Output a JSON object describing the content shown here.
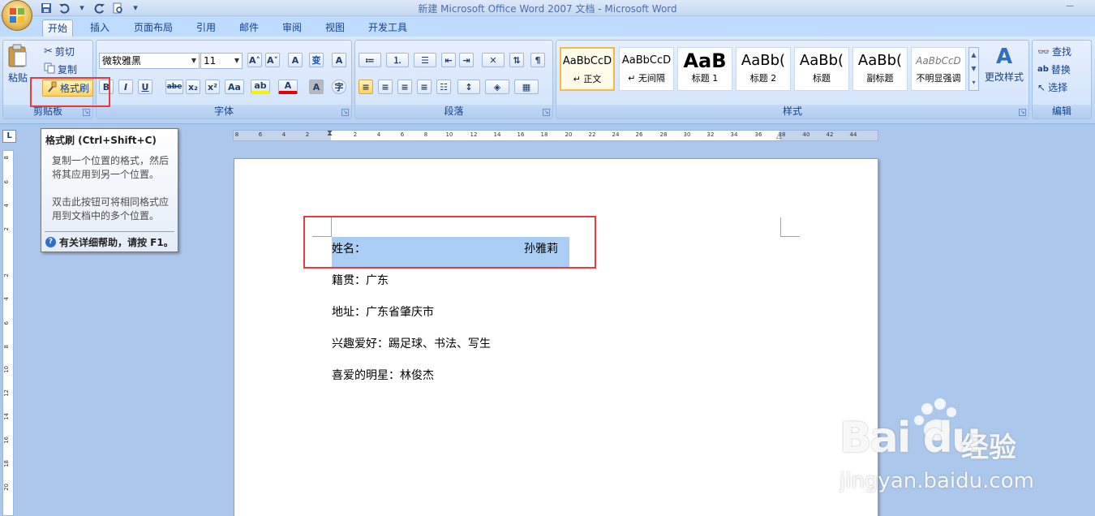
{
  "window": {
    "title": "新建 Microsoft Office Word 2007 文档 - Microsoft Word",
    "minimize_glyph": "—"
  },
  "quick_access": {
    "icons": [
      "save-icon",
      "undo-icon",
      "dropdown-icon",
      "redo-icon",
      "print-preview-icon",
      "customize-icon"
    ],
    "undo_arrow": "▾",
    "customize_arrow": "▾"
  },
  "tabs": [
    {
      "label": "开始",
      "active": true
    },
    {
      "label": "插入"
    },
    {
      "label": "页面布局"
    },
    {
      "label": "引用"
    },
    {
      "label": "邮件"
    },
    {
      "label": "审阅"
    },
    {
      "label": "视图"
    },
    {
      "label": "开发工具"
    }
  ],
  "clipboard": {
    "group_label": "剪贴板",
    "paste_label": "粘贴",
    "cut_label": "剪切",
    "copy_label": "复制",
    "format_painter_label": "格式刷"
  },
  "font": {
    "group_label": "字体",
    "font_name": "微软雅黑",
    "font_size": "11",
    "bold": "B",
    "italic": "I",
    "underline": "U",
    "strikethrough": "abe",
    "subscript": "x₂",
    "superscript": "x²",
    "change_case": "Aa",
    "highlight": "ab",
    "font_color": "A",
    "char_shading": "A",
    "enclose": "字",
    "grow": "A˄",
    "shrink": "A˅",
    "clear": "A",
    "phonetic": "变",
    "border": "A",
    "highlight_color": "#f7f000",
    "font_color_bar": "#e40000"
  },
  "paragraph": {
    "group_label": "段落"
  },
  "styles": {
    "group_label": "样式",
    "items": [
      {
        "sample": "AaBbCcD",
        "name": "↵ 正文",
        "selected": true
      },
      {
        "sample": "AaBbCcD",
        "name": "↵ 无间隔"
      },
      {
        "sample": "AaB",
        "name": "标题 1"
      },
      {
        "sample": "AaBb(",
        "name": "标题 2"
      },
      {
        "sample": "AaBb(",
        "name": "标题"
      },
      {
        "sample": "AaBb(",
        "name": "副标题"
      },
      {
        "sample": "AaBbCcD",
        "name": "不明显强调"
      }
    ],
    "change_styles_label": "更改样式"
  },
  "editing": {
    "group_label": "编辑",
    "find_label": "查找",
    "replace_label": "替换",
    "select_label": "选择"
  },
  "ruler": {
    "corner_glyph": "L",
    "h_ticks": [
      "8",
      "6",
      "4",
      "2",
      "2",
      "4",
      "6",
      "8",
      "10",
      "12",
      "14",
      "16",
      "18",
      "20",
      "22",
      "24",
      "26",
      "28",
      "30",
      "32",
      "34",
      "36",
      "38",
      "40",
      "42",
      "44"
    ],
    "v_ticks": [
      "8",
      "6",
      "4",
      "2",
      "2",
      "4",
      "6",
      "8",
      "10",
      "12",
      "14",
      "16",
      "18",
      "20"
    ]
  },
  "tooltip": {
    "title": "格式刷 (Ctrl+Shift+C)",
    "body1": "复制一个位置的格式，然后将其应用到另一个位置。",
    "body2": "双击此按钮可将相同格式应用到文档中的多个位置。",
    "help": "有关详细帮助，请按 F1。",
    "help_glyph": "?"
  },
  "document": {
    "line1_label": "姓名：",
    "line1_value": "孙雅莉",
    "line2": "籍贯：广东",
    "line3": "地址：广东省肇庆市",
    "line4": "兴趣爱好：踢足球、书法、写生",
    "line5": "喜爱的明星：林俊杰"
  },
  "watermark": {
    "logo": "Bai du",
    "text": "经验",
    "url": "jingyan.baidu.com"
  },
  "colors": {
    "annotation_red": "#e53d3d",
    "selection_blue": "#a9cdf3"
  }
}
